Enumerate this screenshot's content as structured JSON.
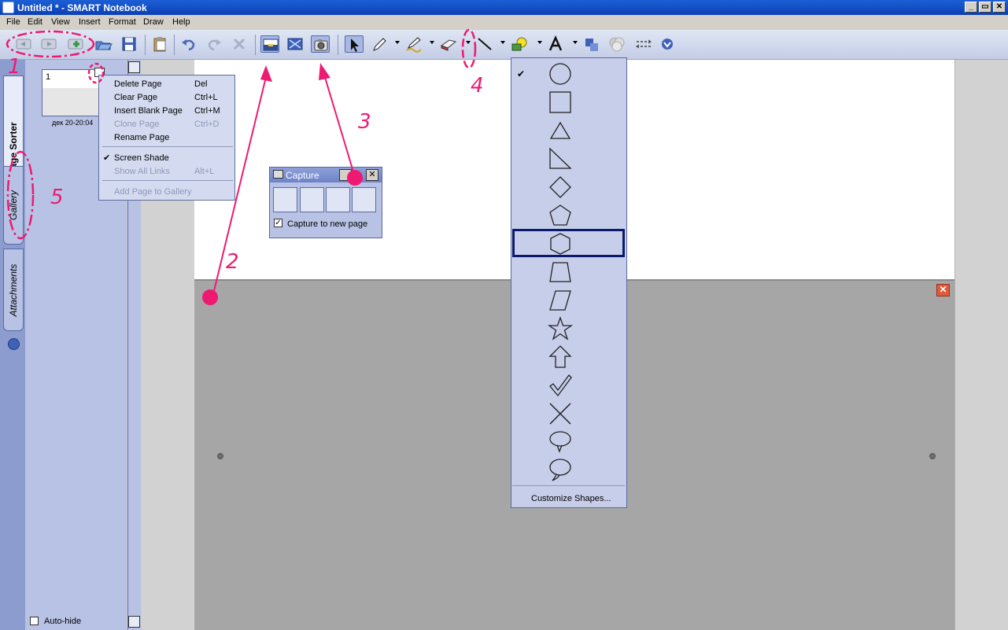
{
  "window": {
    "title": "Untitled * - SMART Notebook",
    "controls": [
      "_",
      "▭",
      "✕"
    ]
  },
  "menu": [
    "File",
    "Edit",
    "View",
    "Insert",
    "Format",
    "Draw",
    "Help"
  ],
  "toolbar": {
    "buttons": [
      "back-icon",
      "forward-icon",
      "add-page-icon",
      "open-icon",
      "save-icon",
      "paste-icon",
      "undo-icon",
      "redo-icon",
      "delete-icon",
      "screen-shade-icon",
      "full-screen-icon",
      "capture-icon",
      "select-icon",
      "pen-icon",
      "creative-pen-icon",
      "eraser-icon",
      "line-icon",
      "shapes-icon",
      "text-icon",
      "fill-icon",
      "properties-icon",
      "move-toolbar-icon",
      "more-icon"
    ]
  },
  "side_tabs": {
    "page_sorter": "Page Sorter",
    "gallery": "Gallery",
    "attachments": "Attachments"
  },
  "sorter": {
    "page_number": "1",
    "page_date": "дек 20-20:04",
    "autohide": "Auto-hide"
  },
  "context_menu": {
    "items": [
      {
        "label": "Delete Page",
        "shortcut": "Del",
        "enabled": true
      },
      {
        "label": "Clear Page",
        "shortcut": "Ctrl+L",
        "enabled": true
      },
      {
        "label": "Insert Blank Page",
        "shortcut": "Ctrl+M",
        "enabled": true
      },
      {
        "label": "Clone Page",
        "shortcut": "Ctrl+D",
        "enabled": false
      },
      {
        "label": "Rename Page",
        "shortcut": "",
        "enabled": true
      },
      {
        "label": "Screen Shade",
        "shortcut": "",
        "enabled": true,
        "checked": true
      },
      {
        "label": "Show All Links",
        "shortcut": "Alt+L",
        "enabled": false
      },
      {
        "label": "Add Page to Gallery",
        "shortcut": "",
        "enabled": false
      }
    ]
  },
  "capture_dialog": {
    "title": "Capture",
    "checkbox_label": "Capture to new page",
    "checked": true
  },
  "shapes_menu": {
    "items": [
      "circle",
      "square",
      "triangle",
      "right-triangle",
      "diamond",
      "pentagon",
      "hexagon",
      "trapezoid",
      "parallelogram",
      "star",
      "arrow-up",
      "checkmark",
      "x-mark",
      "speech-bubble",
      "thought-bubble"
    ],
    "selected": "hexagon",
    "checked": "circle",
    "customize": "Customize Shapes..."
  },
  "annotations": [
    "1",
    "2",
    "3",
    "4",
    "5"
  ],
  "colors": {
    "title_bar": "#0a3fb4",
    "annotation": "#ee1a72",
    "panel": "#b8c2e4",
    "shade": "#a6a6a6"
  }
}
